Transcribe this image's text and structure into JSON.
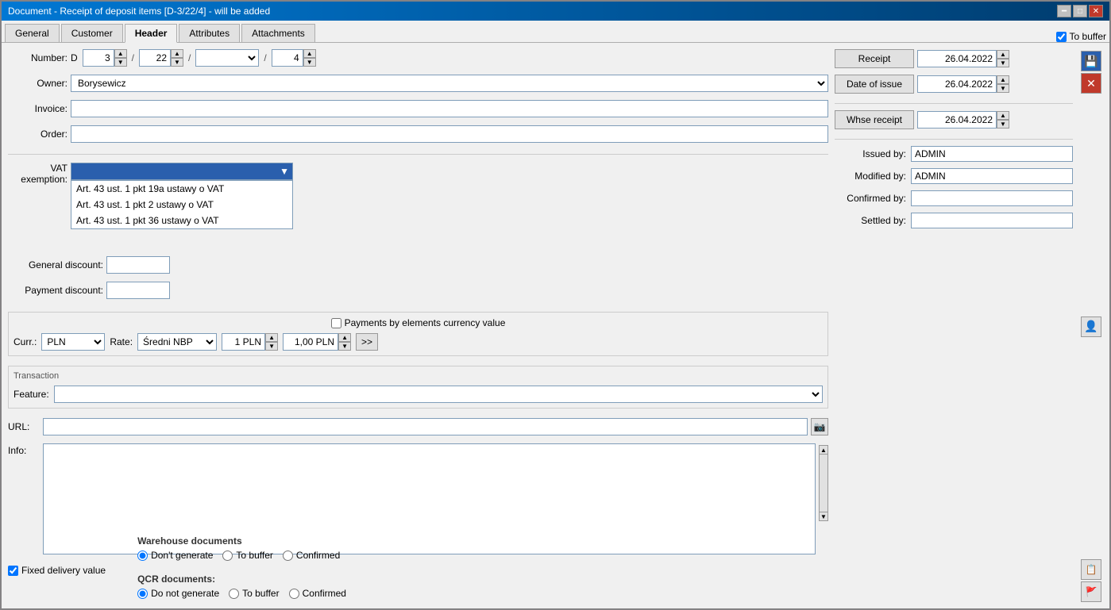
{
  "window": {
    "title": "Document - Receipt of deposit items [D-3/22/4]  - will be added",
    "titlebar_buttons": [
      "minimize",
      "maximize",
      "close"
    ]
  },
  "tabs": [
    {
      "label": "General",
      "active": false
    },
    {
      "label": "Customer",
      "active": false
    },
    {
      "label": "Header",
      "active": true
    },
    {
      "label": "Attributes",
      "active": false
    },
    {
      "label": "Attachments",
      "active": false
    }
  ],
  "to_buffer": {
    "label": "To buffer",
    "checked": true
  },
  "form": {
    "number_label": "Number:",
    "number_prefix": "D",
    "number_val1": "3",
    "number_val2": "22",
    "number_val3": "",
    "number_val4": "4",
    "owner_label": "Owner:",
    "owner_value": "Borysewicz",
    "invoice_label": "Invoice:",
    "invoice_value": "",
    "order_label": "Order:",
    "order_value": "",
    "vat_exemption_label": "VAT exemption:",
    "vat_selected": "",
    "vat_options": [
      {
        "value": "art43a",
        "label": "Art. 43 ust. 1 pkt 19a ustawy o VAT"
      },
      {
        "value": "art43_2",
        "label": "Art. 43 ust.  1 pkt 2 ustawy o VAT"
      },
      {
        "value": "art43_36",
        "label": "Art. 43 ust.  1 pkt 36 ustawy o VAT"
      }
    ],
    "general_discount_label": "General discount:",
    "general_discount_value": "",
    "payment_discount_label": "Payment discount:",
    "payment_discount_value": ""
  },
  "right_panel": {
    "receipt_btn_label": "Receipt",
    "receipt_date": "26.04.2022",
    "date_of_issue_btn_label": "Date of issue",
    "date_of_issue_date": "26.04.2022",
    "whse_receipt_btn_label": "Whse receipt",
    "whse_receipt_date": "26.04.2022",
    "issued_by_label": "Issued by:",
    "issued_by_value": "ADMIN",
    "modified_by_label": "Modified by:",
    "modified_by_value": "ADMIN",
    "confirmed_by_label": "Confirmed by:",
    "confirmed_by_value": "",
    "settled_by_label": "Settled by:",
    "settled_by_value": ""
  },
  "currency_section": {
    "payments_by_elements_label": "Payments by elements currency value",
    "curr_label": "Curr.:",
    "curr_value": "PLN",
    "rate_label": "Rate:",
    "rate_value": "Średni NBP",
    "rate_amount": "1 PLN",
    "rate_display": "1,00 PLN",
    "forward_btn": ">>"
  },
  "transaction_section": {
    "title": "Transaction",
    "feature_label": "Feature:",
    "feature_value": ""
  },
  "url_row": {
    "url_label": "URL:",
    "url_value": "",
    "url_btn_icon": "📷"
  },
  "info_row": {
    "info_label": "Info:",
    "info_value": ""
  },
  "warehouse_section": {
    "title": "Warehouse documents",
    "options": [
      {
        "label": "Don't generate",
        "selected": true
      },
      {
        "label": "To buffer",
        "selected": false
      },
      {
        "label": "Confirmed",
        "selected": false
      }
    ]
  },
  "qcr_section": {
    "title": "QCR documents:",
    "options": [
      {
        "label": "Do not generate",
        "selected": true
      },
      {
        "label": "To buffer",
        "selected": false
      },
      {
        "label": "Confirmed",
        "selected": false
      }
    ]
  },
  "fixed_delivery": {
    "label": "Fixed delivery value",
    "checked": true
  }
}
